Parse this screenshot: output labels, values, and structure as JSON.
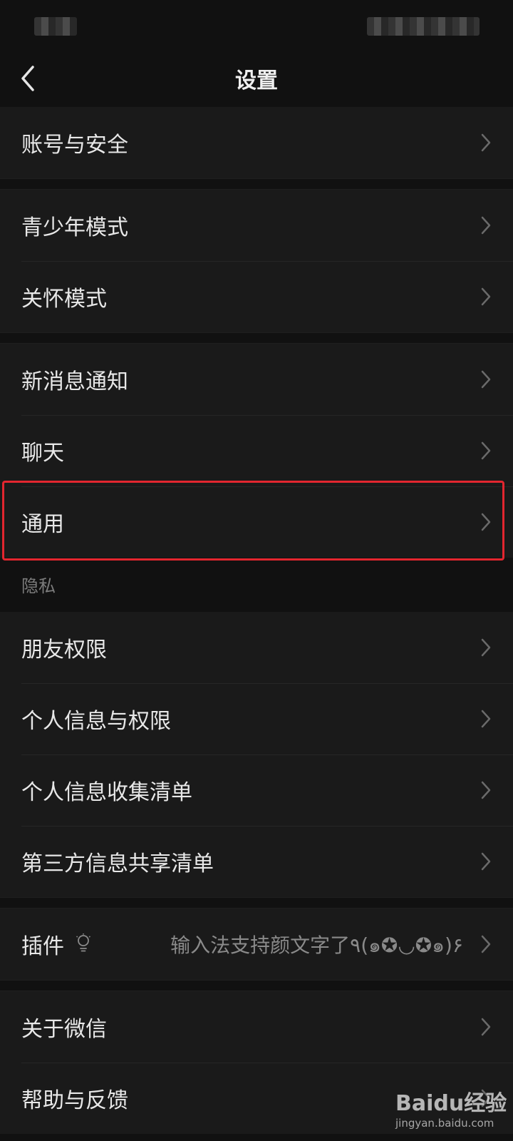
{
  "nav": {
    "title": "设置"
  },
  "items": {
    "account_security": "账号与安全",
    "teen_mode": "青少年模式",
    "care_mode": "关怀模式",
    "new_message_notification": "新消息通知",
    "chat": "聊天",
    "general": "通用",
    "friend_permissions": "朋友权限",
    "personal_info_permissions": "个人信息与权限",
    "personal_info_collection": "个人信息收集清单",
    "third_party_sharing": "第三方信息共享清单",
    "plugins": "插件",
    "plugins_value": "输入法支持颜文字了٩(๑✪◡✪๑)۶",
    "about": "关于微信",
    "help_feedback": "帮助与反馈"
  },
  "sections": {
    "privacy": "隐私"
  },
  "icons": {
    "back": "back-arrow-icon",
    "chevron": "chevron-right-icon",
    "plugin_badge": "lightbulb-icon"
  },
  "watermark": {
    "brand": "Baidu经验",
    "url": "jingyan.baidu.com"
  },
  "colors": {
    "background": "#111111",
    "row": "#1a1a1a",
    "highlight": "#e3262f"
  }
}
